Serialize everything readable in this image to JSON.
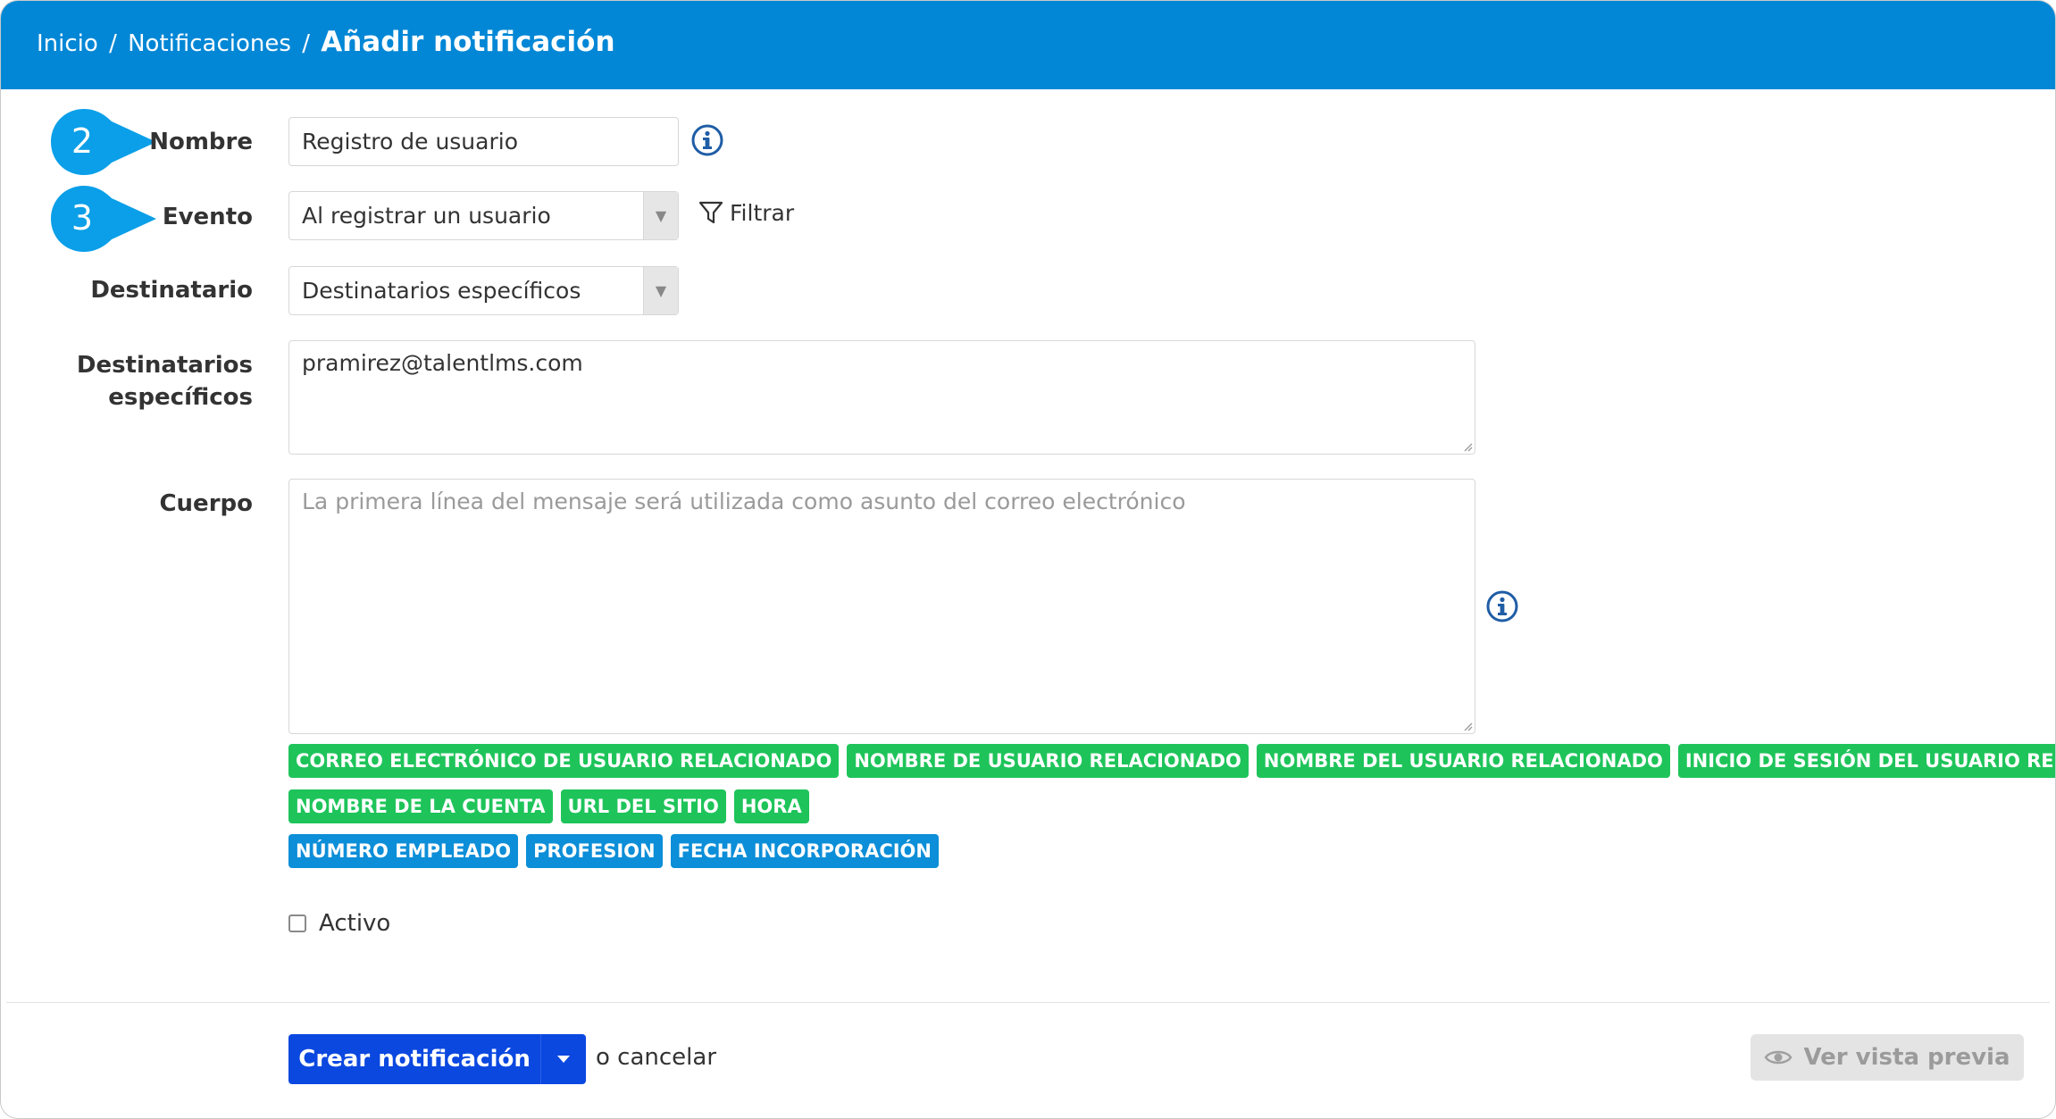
{
  "breadcrumb": {
    "items": [
      "Inicio",
      "Notificaciones"
    ],
    "separator": "/",
    "current": "Añadir notificación"
  },
  "callouts": [
    "2",
    "3"
  ],
  "form": {
    "name_label": "Nombre",
    "name_value": "Registro de usuario",
    "event_label": "Evento",
    "event_value": "Al registrar un usuario",
    "filter_label": "Filtrar",
    "recipient_label": "Destinatario",
    "recipient_value": "Destinatarios específicos",
    "specific_label_line1": "Destinatarios",
    "specific_label_line2": "específicos",
    "specific_value": "pramirez@talentlms.com",
    "body_label": "Cuerpo",
    "body_placeholder": "La primera línea del mensaje será utilizada como asunto del correo electrónico",
    "active_label": "Activo",
    "active_checked": false
  },
  "tags": {
    "row1": [
      "CORREO ELECTRÓNICO DE USUARIO RELACIONADO",
      "NOMBRE DE USUARIO RELACIONADO",
      "NOMBRE DEL USUARIO RELACIONADO",
      "INICIO DE SESIÓN DEL USUARIO RELACIONADO"
    ],
    "row2": [
      "NOMBRE DE LA CUENTA",
      "URL DEL SITIO",
      "HORA"
    ],
    "row3": [
      "NÚMERO EMPLEADO",
      "PROFESION",
      "FECHA INCORPORACIÓN"
    ]
  },
  "footer": {
    "create_label": "Crear notificación",
    "cancel_label": "o cancelar",
    "preview_label": "Ver vista previa"
  },
  "colors": {
    "header": "#0287d6",
    "callout": "#0a9fe8",
    "tag_system": "#1ec45a",
    "tag_custom": "#0c8ed8",
    "primary_button": "#0b48e0",
    "info_icon": "#1f5da6"
  },
  "icons": [
    "info-icon",
    "funnel-icon",
    "caret-down-icon",
    "eye-icon",
    "resize-grip-icon"
  ]
}
